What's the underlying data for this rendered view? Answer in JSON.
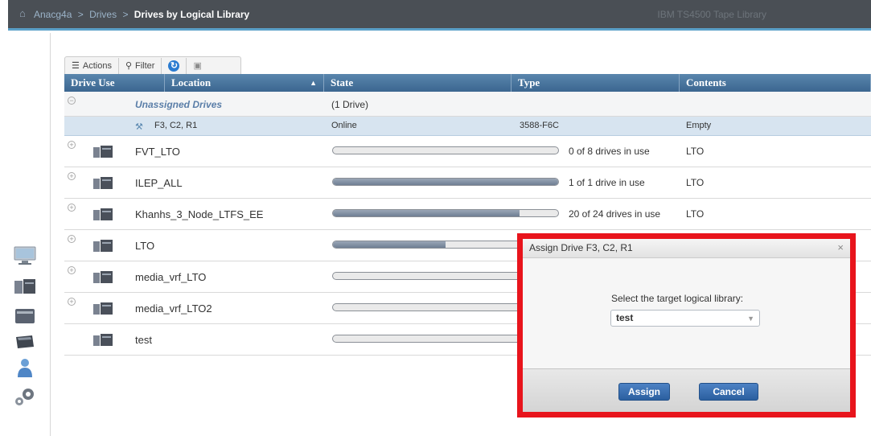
{
  "topbar": {
    "crumb_root": "Anacg4a",
    "crumb_sep": ">",
    "crumb_mid": "Drives",
    "crumb_current": "Drives by Logical Library",
    "product": "IBM TS4500 Tape Library"
  },
  "toolbar": {
    "actions_label": "Actions",
    "filter_label": "Filter"
  },
  "table": {
    "headers": [
      "Drive Use",
      "Location",
      "State",
      "Type",
      "Contents"
    ],
    "unassigned": {
      "label": "Unassigned Drives",
      "count": "(1 Drive)",
      "drive": {
        "location": "F3, C2, R1",
        "state": "Online",
        "type": "3588-F6C",
        "contents": "Empty"
      }
    },
    "libraries": [
      {
        "name": "FVT_LTO",
        "usage": "0 of 8 drives in use",
        "fill": 0,
        "contents": "LTO"
      },
      {
        "name": "ILEP_ALL",
        "usage": "1 of 1 drive in use",
        "fill": 1.0,
        "contents": "LTO"
      },
      {
        "name": "Khanhs_3_Node_LTFS_EE",
        "usage": "20 of 24 drives in use",
        "fill": 0.83,
        "contents": "LTO"
      },
      {
        "name": "LTO",
        "usage": "",
        "fill": 0.5,
        "contents": ""
      },
      {
        "name": "media_vrf_LTO",
        "usage": "",
        "fill": 0,
        "contents": ""
      },
      {
        "name": "media_vrf_LTO2",
        "usage": "",
        "fill": 0,
        "contents": ""
      },
      {
        "name": "test",
        "usage": "",
        "fill": 0,
        "contents": ""
      }
    ]
  },
  "dialog": {
    "title": "Assign Drive F3, C2, R1",
    "close": "×",
    "prompt": "Select the target logical library:",
    "selected": "test",
    "assign_label": "Assign",
    "cancel_label": "Cancel"
  },
  "colors": {
    "header": "#3b6690",
    "highlight": "#e8141c",
    "button": "#2b5f9f"
  }
}
